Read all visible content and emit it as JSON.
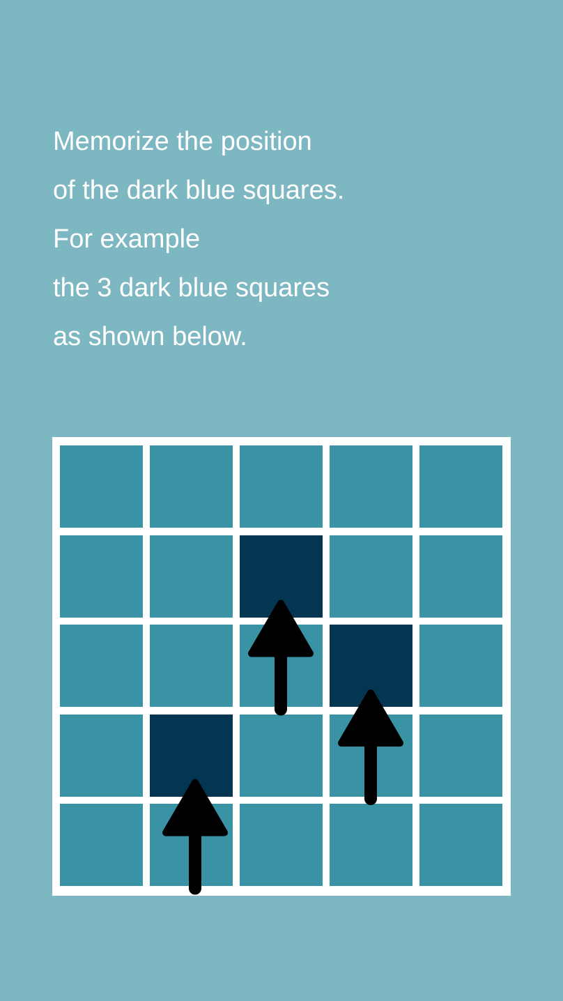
{
  "instructions": {
    "lines": [
      "Memorize the position",
      "of the dark blue squares.",
      "For example",
      "the 3 dark blue squares",
      "as shown below."
    ]
  },
  "grid": {
    "rows": 5,
    "cols": 5,
    "dark_cells": [
      {
        "row": 1,
        "col": 2
      },
      {
        "row": 2,
        "col": 3
      },
      {
        "row": 3,
        "col": 1
      }
    ],
    "arrows_point_to": [
      {
        "row": 1,
        "col": 2
      },
      {
        "row": 2,
        "col": 3
      },
      {
        "row": 3,
        "col": 1
      }
    ]
  },
  "colors": {
    "background": "#7db7c2",
    "board": "#ffffff",
    "cell": "#3a93a5",
    "dark_cell": "#053651",
    "text": "#ffffff",
    "arrow": "#000000"
  },
  "icons": {
    "arrow": "arrow-up-icon"
  }
}
